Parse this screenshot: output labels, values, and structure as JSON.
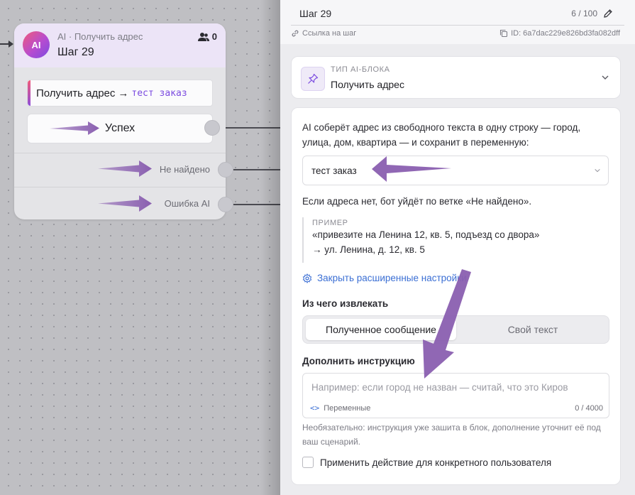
{
  "node": {
    "badge": "AI",
    "subtitle": "AI · Получить адрес",
    "title": "Шаг 29",
    "users_count": "0",
    "action_label": "Получить адрес",
    "action_arrow": "→",
    "action_var": "тест заказ",
    "branches": {
      "success": "Успех",
      "not_found": "Не найдено",
      "ai_error": "Ошибка AI"
    }
  },
  "panel": {
    "step_name": "Шаг 29",
    "step_counter": "6 / 100",
    "link_label": "Ссылка на шаг",
    "step_id": "ID: 6a7dac229e826bd3fa082dff",
    "type_label": "ТИП AI-БЛОКА",
    "type_value": "Получить адрес",
    "description": "AI соберёт адрес из свободного текста в одну строку — город, улица, дом, квартира — и сохранит в переменную:",
    "variable_select": "тест заказ",
    "not_found_hint": "Если адреса нет, бот уйдёт по ветке «Не найдено».",
    "example_label": "ПРИМЕР",
    "example_line1": "«привезите на Ленина 12, кв. 5, подъезд со двора»",
    "example_line2": "→ ул. Ленина, д. 12, кв. 5",
    "advanced_link": "Закрыть расширенные настройки",
    "source_title": "Из чего извлекать",
    "source_options": [
      "Полученное сообщение",
      "Свой текст"
    ],
    "instruction_title": "Дополнить инструкцию",
    "instruction_placeholder": "Например: если город не назван — считай, что это Киров",
    "vars_label": "Переменные",
    "vars_code": "<>",
    "char_count": "0 / 4000",
    "help_text": "Необязательно: инструкция уже зашита в блок, дополнение уточнит её под ваш сценарий.",
    "apply_checkbox": "Применить действие для конкретного пользователя"
  },
  "colors": {
    "annotation_arrow": "#8a5fb0",
    "accent_link": "#3b6fd4",
    "ai_purple": "#7b4be0"
  }
}
